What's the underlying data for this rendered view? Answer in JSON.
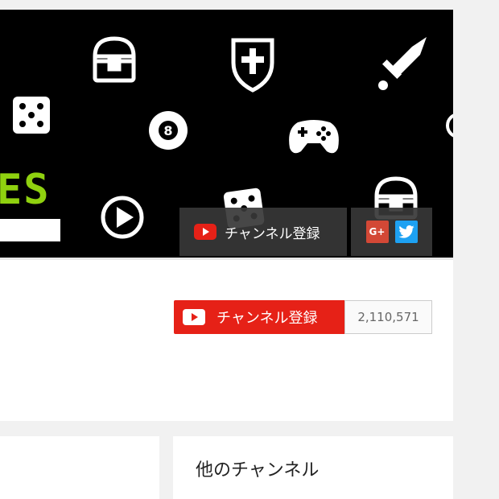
{
  "banner": {
    "logo_text": "ES",
    "overlay_subscribe_label": "チャンネル登録",
    "social_icons": [
      "google-plus-icon",
      "twitter-icon"
    ],
    "gplus_text": "G+"
  },
  "header": {
    "subscribe_label": "チャンネル登録",
    "subscriber_count": "2,110,571"
  },
  "side_panel": {
    "title": "他のチャンネル"
  },
  "colors": {
    "youtube_red": "#e62117",
    "banner_bg": "#000000",
    "logo_green": "#8fd10f",
    "gplus": "#d34836",
    "twitter": "#1da1f2"
  }
}
